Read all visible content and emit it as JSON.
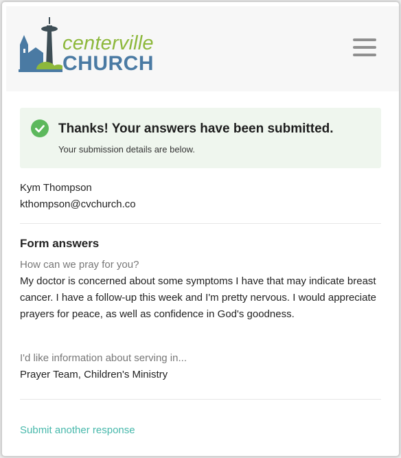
{
  "header": {
    "logo": {
      "line1": "centerville",
      "line2": "CHURCH"
    },
    "menu_icon": "hamburger-menu-icon"
  },
  "alert": {
    "icon": "check-circle-icon",
    "title": "Thanks! Your answers have been submitted.",
    "subtitle": "Your submission details are below.",
    "colors": {
      "background": "#eff6ee",
      "icon": "#5cb85c"
    }
  },
  "submitter": {
    "name": "Kym Thompson",
    "email": "kthompson@cvchurch.co"
  },
  "form_answers": {
    "title": "Form answers",
    "items": [
      {
        "question": "How can we pray for you?",
        "answer": "My doctor is concerned about some symptoms I have that may indicate breast cancer. I have a follow-up this week and I'm pretty nervous. I would appreciate prayers for peace, as well as confidence in God's goodness."
      },
      {
        "question": "I'd like information about serving in...",
        "answer": "Prayer Team, Children's Ministry"
      }
    ]
  },
  "actions": {
    "submit_another": "Submit another response",
    "link_color": "#47b8ab"
  },
  "brand_colors": {
    "green": "#8db83c",
    "blue": "#4a7aa3"
  }
}
